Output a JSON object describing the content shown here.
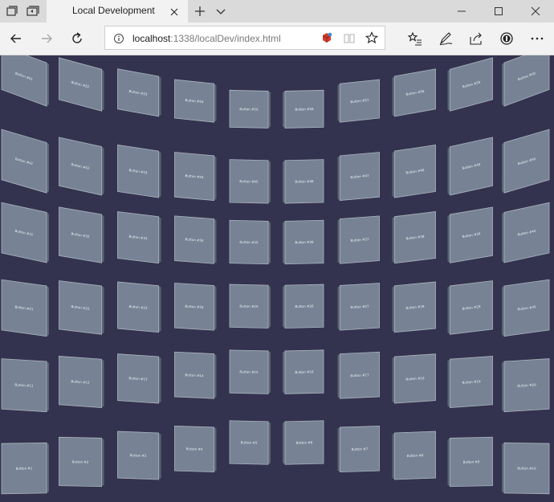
{
  "browser": {
    "tab_title": "Local Development",
    "url_host": "localhost",
    "url_path": ":1338/localDev/index.html",
    "icons": {
      "tab_actions": "tab-set-aside-icon",
      "tab_preview": "show-tabs-icon",
      "close_tab": "close-icon",
      "new_tab": "plus-icon",
      "tab_list": "chevron-down-icon",
      "back": "arrow-left-icon",
      "forward": "arrow-right-icon",
      "refresh": "refresh-icon",
      "site_info": "info-icon",
      "extension": "extension-icon",
      "reading_view": "book-icon",
      "favorite": "star-icon",
      "favorites_hub": "favorites-list-icon",
      "notes": "pen-icon",
      "share": "share-icon",
      "password_manager": "key-icon",
      "more": "more-icon"
    }
  },
  "grid": {
    "rows": [
      [
        "Button #51",
        "Button #52",
        "Button #53",
        "Button #54",
        "Button #55",
        "Button #56",
        "Button #57",
        "Button #58",
        "Button #59",
        "Button #60"
      ],
      [
        "Button #41",
        "Button #42",
        "Button #43",
        "Button #44",
        "Button #45",
        "Button #46",
        "Button #47",
        "Button #48",
        "Button #49",
        "Button #50"
      ],
      [
        "Button #31",
        "Button #32",
        "Button #33",
        "Button #34",
        "Button #35",
        "Button #36",
        "Button #37",
        "Button #38",
        "Button #39",
        "Button #40"
      ],
      [
        "Button #21",
        "Button #22",
        "Button #23",
        "Button #24",
        "Button #25",
        "Button #26",
        "Button #27",
        "Button #28",
        "Button #29",
        "Button #30"
      ],
      [
        "Button #11",
        "Button #12",
        "Button #13",
        "Button #14",
        "Button #15",
        "Button #16",
        "Button #17",
        "Button #18",
        "Button #19",
        "Button #20"
      ],
      [
        "Button #1",
        "Button #2",
        "Button #3",
        "Button #4",
        "Button #5",
        "Button #6",
        "Button #7",
        "Button #8",
        "Button #9",
        "Button #10"
      ]
    ]
  },
  "colors": {
    "scene_background": "#34334f",
    "tile_face": "#7d8a9a",
    "tile_border": "#a9b4c0",
    "tile_text": "#eef2f6"
  }
}
